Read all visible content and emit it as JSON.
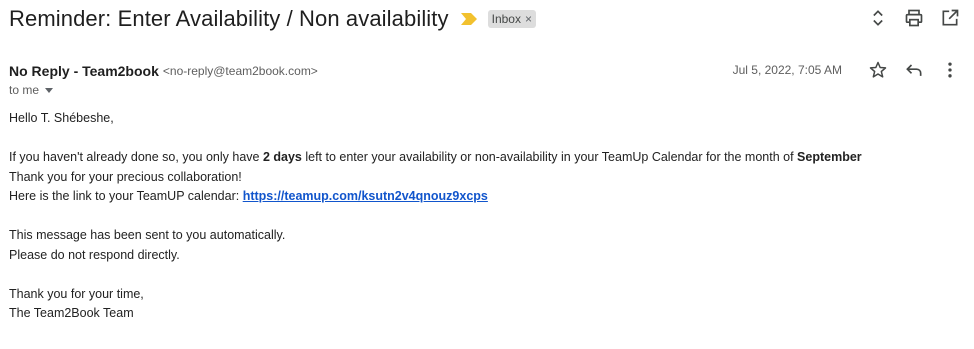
{
  "subject": {
    "title": "Reminder: Enter Availability / Non availability",
    "label": "Inbox",
    "label_remove": "×",
    "importance_color": "#f2c12e"
  },
  "top_actions": {
    "icons": [
      "expand-collapse-icon",
      "print-icon",
      "open-in-new-window-icon"
    ]
  },
  "sender": {
    "name": "No Reply - Team2book",
    "email": "<no-reply@team2book.com>",
    "to": "to me",
    "date": "Jul 5, 2022, 7:05 AM"
  },
  "message_actions": {
    "icons": [
      "star-icon",
      "reply-icon",
      "more-vert-icon"
    ]
  },
  "body": {
    "greeting": "Hello T. Shébeshe,",
    "p1_pre": "If you haven't already done so, you only have ",
    "p1_bold": "2 days",
    "p1_mid": " left to enter your availability or non-availability in your TeamUp Calendar for the month of ",
    "p1_month": "September",
    "thanks": "Thank you for your precious collaboration!",
    "link_pre": "Here is the link to your TeamUP calendar: ",
    "link": "https://teamup.com/ksutn2v4qnouz9xcps",
    "auto": "This message has been sent to you automatically.",
    "noreply": "Please do not respond directly.",
    "closing": "Thank you for your time,",
    "signature": "The Team2Book Team"
  },
  "colors": {
    "link": "#1155cc",
    "label_bg": "#dddddd",
    "muted": "#5e5e5e"
  }
}
